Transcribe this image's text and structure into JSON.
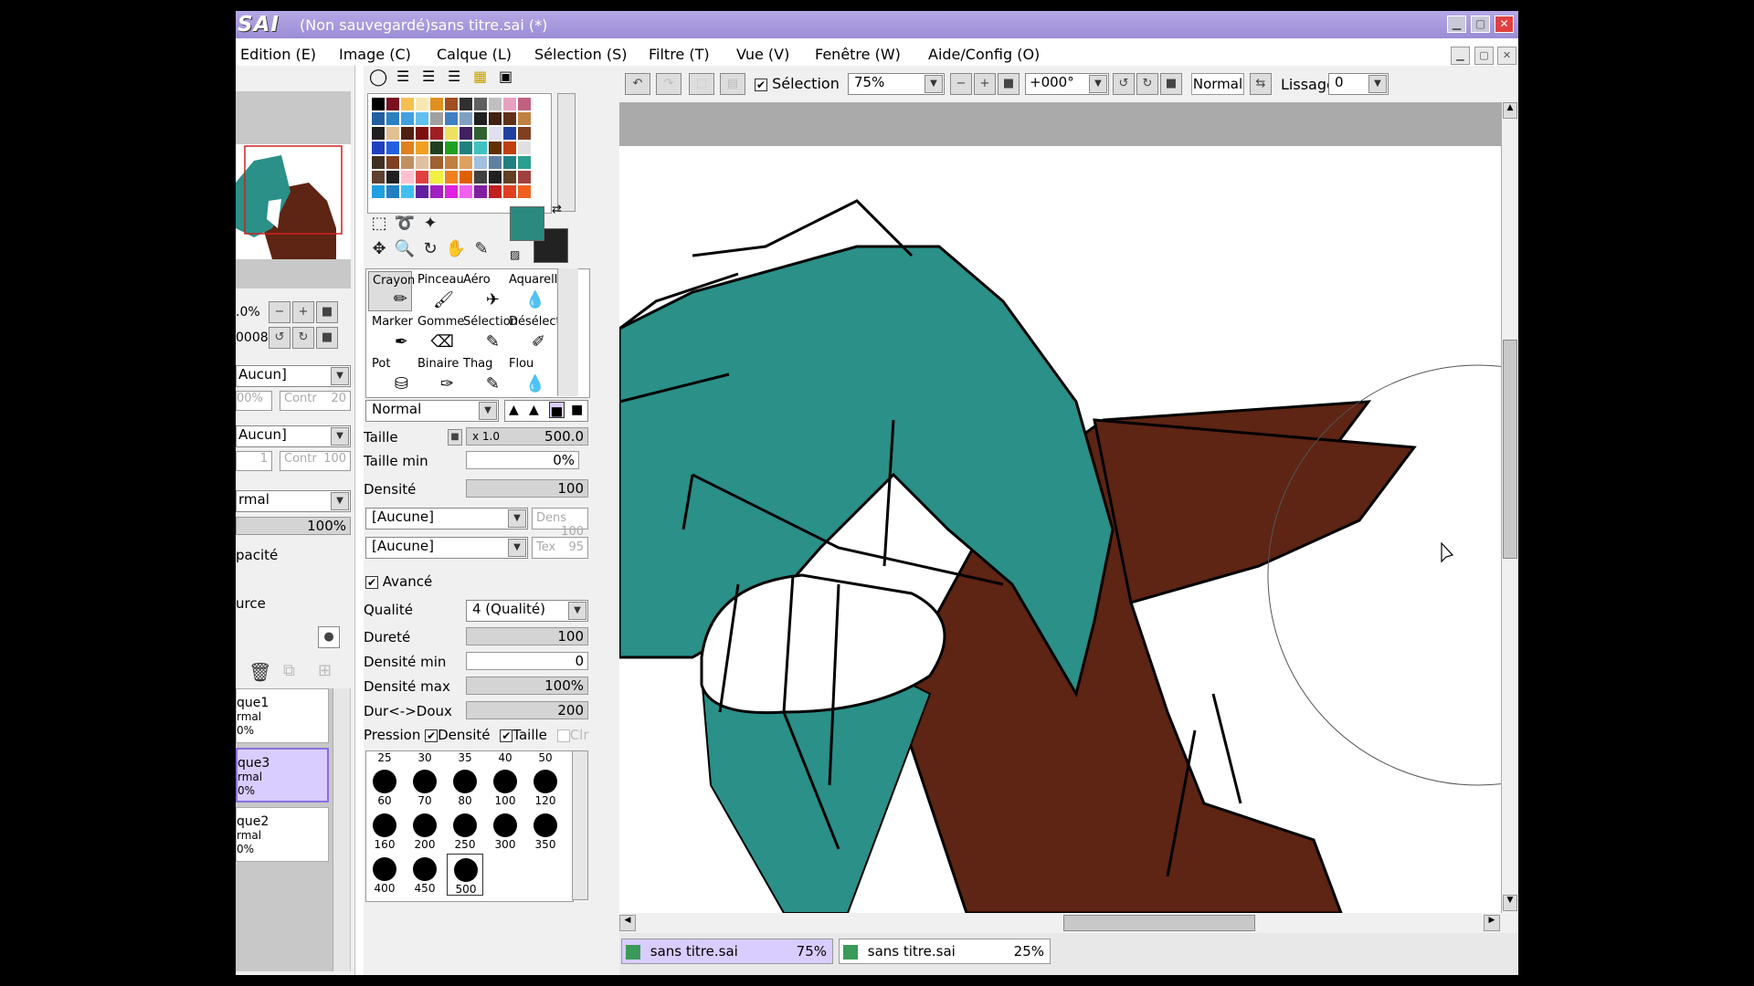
{
  "app": {
    "logo": "SAI",
    "window_title": "(Non sauvegardé)sans titre.sai (*)"
  },
  "menu": [
    "Edition (E)",
    "Image (C)",
    "Calque (L)",
    "Sélection (S)",
    "Filtre (T)",
    "Vue (V)",
    "Fenêtre (W)",
    "Aide/Config (O)"
  ],
  "toolbar": {
    "selection_label": "Sélection",
    "zoom": "75%",
    "rotation": "+000°",
    "blend": "Normal",
    "lissage_label": "Lissage",
    "lissage_value": "0"
  },
  "left": {
    "zoom_partial": ".0%",
    "angle_partial": "0008",
    "filter1": "Aucun]",
    "opacity_partial": "00%",
    "contr1_label": "Contr",
    "contr1_value": "20",
    "filter2": "Aucun]",
    "num1": "1",
    "contr2_label": "Contr",
    "contr2_value": "100",
    "mode_partial": "rmal",
    "opacity_value": "100%",
    "opacite_partial": "pacité",
    "source_partial": "urce",
    "layers": [
      {
        "name": "que1",
        "mode": "rmal",
        "pct": "0%"
      },
      {
        "name": "que3",
        "mode": "rmal",
        "pct": "0%"
      },
      {
        "name": "que2",
        "mode": "rmal",
        "pct": "0%"
      }
    ]
  },
  "tools": {
    "brushes": [
      {
        "name": "Crayon",
        "icon": "pencil-icon"
      },
      {
        "name": "Pinceau",
        "icon": "brush-icon"
      },
      {
        "name": "Aéro",
        "icon": "airbrush-icon"
      },
      {
        "name": "Aquarell",
        "icon": "watercolor-icon"
      },
      {
        "name": "Marker",
        "icon": "marker-icon"
      },
      {
        "name": "Gomme",
        "icon": "eraser-icon"
      },
      {
        "name": "Sélection",
        "icon": "select-brush-icon"
      },
      {
        "name": "Désélect",
        "icon": "deselect-brush-icon"
      },
      {
        "name": "Pot",
        "icon": "bucket-icon"
      },
      {
        "name": "Binaire",
        "icon": "binary-pen-icon"
      },
      {
        "name": "Thag",
        "icon": "thag-icon"
      },
      {
        "name": "Flou",
        "icon": "blur-icon"
      }
    ],
    "brush_mode": "Normal",
    "taille_label": "Taille",
    "taille_mult": "x 1.0",
    "taille_value": "500.0",
    "taille_min_label": "Taille min",
    "taille_min_value": "0%",
    "densite_label": "Densité",
    "densite_value": "100",
    "texture1": "[Aucune]",
    "dens_label": "Dens",
    "dens_value": "100",
    "texture2": "[Aucune]",
    "tex_label": "Tex",
    "tex_value": "95",
    "avance_label": "Avancé",
    "qualite_label": "Qualité",
    "qualite_value": "4 (Qualité)",
    "durete_label": "Dureté",
    "durete_value": "100",
    "densite_min_label": "Densité min",
    "densite_min_value": "0",
    "densite_max_label": "Densité max",
    "densite_max_value": "100%",
    "dur_doux_label": "Dur<->Doux",
    "dur_doux_value": "200",
    "pression_label": "Pression",
    "pression_densite": "Densité",
    "pression_taille": "Taille",
    "pression_clr": "Clr",
    "sizes_top": [
      "25",
      "30",
      "35",
      "40",
      "50"
    ],
    "sizes": [
      "60",
      "70",
      "80",
      "100",
      "120",
      "160",
      "200",
      "250",
      "300",
      "350",
      "400",
      "450",
      "500"
    ]
  },
  "colors": {
    "primary": "#2a8a80",
    "secondary": "#222222",
    "teal": "#2a9088",
    "brown": "#5e2414",
    "accent": "#9b8cd6"
  },
  "tabs": [
    {
      "name": "sans titre.sai",
      "zoom": "75%"
    },
    {
      "name": "sans titre.sai",
      "zoom": "25%"
    }
  ]
}
